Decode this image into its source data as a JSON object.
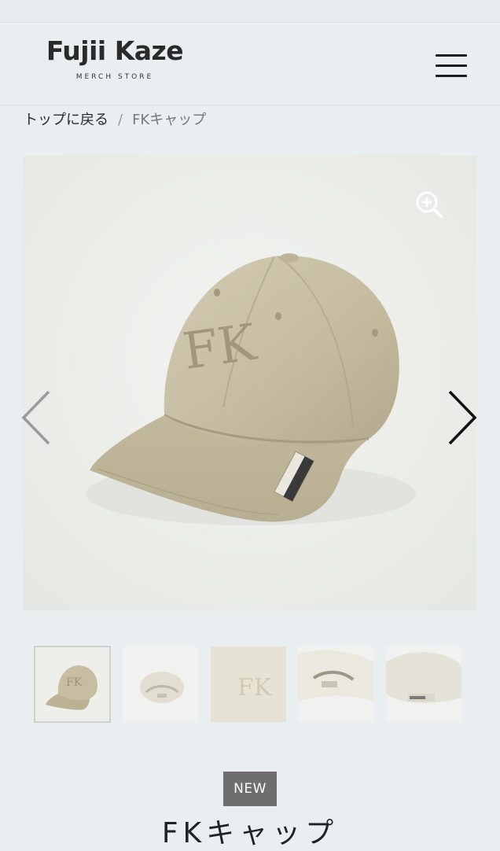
{
  "header": {
    "logo_title": "Fujii Kaze",
    "logo_subtitle": "MERCH STORE",
    "menu_icon": "hamburger-menu-icon"
  },
  "breadcrumb": {
    "back_label": "トップに戻る",
    "separator": "/",
    "current": "FKキャップ"
  },
  "gallery": {
    "main_image": "beige cap with FK embroidery",
    "cap_embroidery": "FK",
    "zoom_icon": "zoom-in-icon",
    "prev_icon": "chevron-left-icon",
    "next_icon": "chevron-right-icon"
  },
  "thumbnails": [
    {
      "label": "cap front angle",
      "active": true
    },
    {
      "label": "cap back view",
      "active": false
    },
    {
      "label": "FK embroidery closeup",
      "active": false
    },
    {
      "label": "strap closeup",
      "active": false
    },
    {
      "label": "brim label closeup",
      "active": false
    }
  ],
  "product": {
    "badge": "NEW",
    "title": "FKキャップ"
  },
  "colors": {
    "background": "#e9eff0",
    "cap_beige": "#c9c0a6",
    "badge_bg": "#6e6e6e"
  }
}
